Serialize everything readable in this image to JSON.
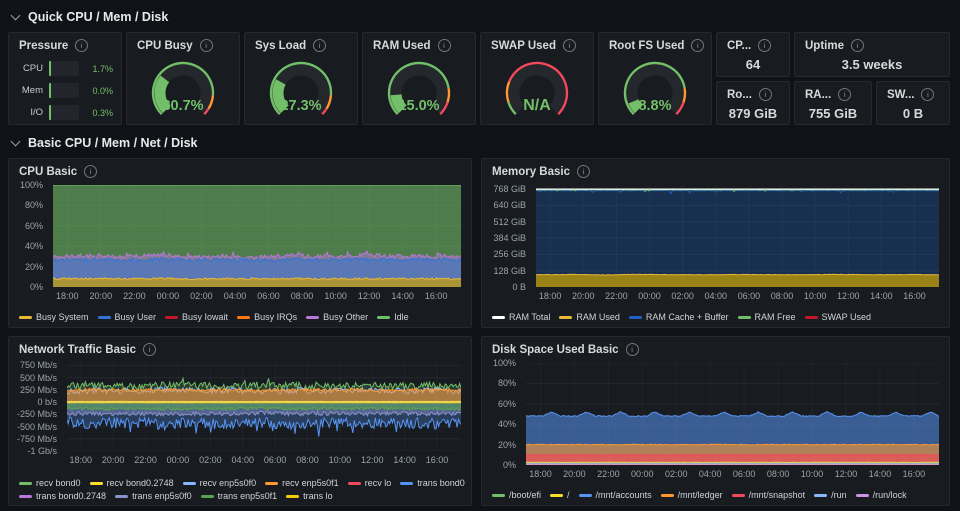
{
  "sections": [
    {
      "title": "Quick CPU / Mem / Disk"
    },
    {
      "title": "Basic CPU / Mem / Net / Disk"
    }
  ],
  "pressure": {
    "title": "Pressure",
    "rows": [
      {
        "label": "CPU",
        "value": "1.7%"
      },
      {
        "label": "Mem",
        "value": "0.0%"
      },
      {
        "label": "I/O",
        "value": "0.3%"
      }
    ],
    "bar_color": "#73bf69"
  },
  "gauges": [
    {
      "title": "CPU Busy",
      "display": "30.7%",
      "percent": 30.7,
      "value_color": "#73bf69",
      "thresholds": [
        {
          "to": 85,
          "color": "#73bf69"
        },
        {
          "to": 95,
          "color": "#ff9830"
        },
        {
          "to": 100,
          "color": "#f2495c"
        }
      ]
    },
    {
      "title": "Sys Load",
      "display": "27.3%",
      "percent": 27.3,
      "value_color": "#73bf69",
      "thresholds": [
        {
          "to": 85,
          "color": "#73bf69"
        },
        {
          "to": 95,
          "color": "#ff9830"
        },
        {
          "to": 100,
          "color": "#f2495c"
        }
      ]
    },
    {
      "title": "RAM Used",
      "display": "15.0%",
      "percent": 15.0,
      "value_color": "#73bf69",
      "thresholds": [
        {
          "to": 80,
          "color": "#73bf69"
        },
        {
          "to": 90,
          "color": "#ff9830"
        },
        {
          "to": 100,
          "color": "#f2495c"
        }
      ]
    },
    {
      "title": "SWAP Used",
      "display": "N/A",
      "percent": null,
      "value_color": "#73bf69",
      "thresholds": [
        {
          "to": 10,
          "color": "#73bf69"
        },
        {
          "to": 25,
          "color": "#ff9830"
        },
        {
          "to": 100,
          "color": "#f2495c"
        }
      ]
    },
    {
      "title": "Root FS Used",
      "display": "8.8%",
      "percent": 8.8,
      "value_color": "#73bf69",
      "thresholds": [
        {
          "to": 80,
          "color": "#73bf69"
        },
        {
          "to": 90,
          "color": "#ff9830"
        },
        {
          "to": 100,
          "color": "#f2495c"
        }
      ]
    }
  ],
  "stats": [
    {
      "title": "CP...",
      "value": "64"
    },
    {
      "title": "Uptime",
      "value": "3.5 weeks"
    },
    {
      "title": "Ro...",
      "value": "879 GiB"
    },
    {
      "title": "RA...",
      "value": "755 GiB"
    },
    {
      "title": "SW...",
      "value": "0 B"
    }
  ],
  "chart_data": [
    {
      "id": "cpu-basic",
      "title": "CPU Basic",
      "type": "area",
      "stacked": true,
      "ylim": [
        0,
        100
      ],
      "yticks": [
        {
          "v": 0,
          "label": "0%"
        },
        {
          "v": 20,
          "label": "20%"
        },
        {
          "v": 40,
          "label": "40%"
        },
        {
          "v": 60,
          "label": "60%"
        },
        {
          "v": 80,
          "label": "80%"
        },
        {
          "v": 100,
          "label": "100%"
        }
      ],
      "xticks": [
        "18:00",
        "20:00",
        "22:00",
        "00:00",
        "02:00",
        "04:00",
        "06:00",
        "08:00",
        "10:00",
        "12:00",
        "14:00",
        "16:00"
      ],
      "legend": [
        {
          "label": "Busy System",
          "color": "#eab839"
        },
        {
          "label": "Busy User",
          "color": "#3274d9"
        },
        {
          "label": "Busy Iowait",
          "color": "#c4162a"
        },
        {
          "label": "Busy IRQs",
          "color": "#ff780a"
        },
        {
          "label": "Busy Other",
          "color": "#b877d9"
        },
        {
          "label": "Idle",
          "color": "#73bf69"
        }
      ],
      "series": [
        {
          "name": "Idle",
          "color": "#73bf69",
          "points": [
            100
          ],
          "noise": 0,
          "fill": 0.6,
          "lw": 1
        },
        {
          "name": "Busy Other",
          "color": "#b877d9",
          "points": [
            30,
            31,
            29.5,
            31.5,
            30,
            30.5,
            29.5,
            31,
            30,
            31.5,
            30,
            30.5,
            30
          ],
          "noise": 2.0,
          "fill": 0.5,
          "lw": 1,
          "spikeP": 0.05,
          "spikeAmp": 3
        },
        {
          "name": "Busy User",
          "color": "#3274d9",
          "points": [
            26,
            27,
            26,
            27.5,
            26.5,
            27,
            26,
            27,
            26.5,
            27.2,
            26.3,
            27,
            26.5
          ],
          "noise": 1.8,
          "fill": 0.5,
          "lw": 1
        },
        {
          "name": "Busy System",
          "color": "#eab839",
          "fillColor": "#cca300",
          "points": [
            8,
            8.3,
            7.8,
            8.4,
            8,
            8.2,
            7.9,
            8.3,
            8,
            8.2,
            7.9,
            8.2,
            8
          ],
          "noise": 0.9,
          "fill": 0.7,
          "lw": 1
        },
        {
          "name": "Busy Iowait",
          "color": "#c4162a",
          "points": [
            0
          ],
          "noise": 0,
          "fill": 0,
          "lw": 0
        },
        {
          "name": "Busy IRQs",
          "color": "#ff780a",
          "points": [
            0
          ],
          "noise": 0,
          "fill": 0,
          "lw": 0
        }
      ]
    },
    {
      "id": "memory-basic",
      "title": "Memory Basic",
      "type": "area",
      "unit": "GiB",
      "ylim": [
        0,
        800
      ],
      "yticks": [
        {
          "v": 0,
          "label": "0 B"
        },
        {
          "v": 128,
          "label": "128 GiB"
        },
        {
          "v": 256,
          "label": "256 GiB"
        },
        {
          "v": 384,
          "label": "384 GiB"
        },
        {
          "v": 512,
          "label": "512 GiB"
        },
        {
          "v": 640,
          "label": "640 GiB"
        },
        {
          "v": 768,
          "label": "768 GiB"
        }
      ],
      "xticks": [
        "18:00",
        "20:00",
        "22:00",
        "00:00",
        "02:00",
        "04:00",
        "06:00",
        "08:00",
        "10:00",
        "12:00",
        "14:00",
        "16:00"
      ],
      "legend": [
        {
          "label": "RAM Total",
          "color": "#ffffff"
        },
        {
          "label": "RAM Used",
          "color": "#eab839"
        },
        {
          "label": "RAM Cache + Buffer",
          "color": "#1f60c4"
        },
        {
          "label": "RAM Free",
          "color": "#73bf69"
        },
        {
          "label": "SWAP Used",
          "color": "#c4162a"
        }
      ],
      "series": [
        {
          "name": "RAM Cache + Buffer",
          "color": "#1f60c4",
          "points": [
            756
          ],
          "noise": 2.2,
          "fill": 0.3,
          "lw": 1,
          "spikeP": 0.03,
          "spikeAmp": -22
        },
        {
          "name": "RAM Used",
          "color": "#eab839",
          "fillColor": "#cca300",
          "points": [
            96,
            98,
            95,
            99,
            97,
            96,
            98,
            96,
            97,
            98,
            96,
            97,
            96
          ],
          "noise": 2,
          "fill": 0.72,
          "lw": 1
        },
        {
          "name": "RAM Free",
          "color": "#73bf69",
          "points": [
            762
          ],
          "noise": 1.5,
          "fill": 0,
          "lw": 1,
          "spikeP": 0.03,
          "spikeAmp": -14
        },
        {
          "name": "RAM Total",
          "color": "#ffffff",
          "points": [
            768
          ],
          "noise": 0,
          "fill": 0,
          "lw": 1.2
        },
        {
          "name": "SWAP Used",
          "color": "#c4162a",
          "points": [
            0
          ],
          "noise": 0,
          "fill": 0,
          "lw": 0
        }
      ]
    },
    {
      "id": "network-traffic-basic",
      "title": "Network Traffic Basic",
      "type": "line",
      "zeroLine": true,
      "ylim": [
        -1000,
        800
      ],
      "yticks": [
        {
          "v": 750,
          "label": "750 Mb/s"
        },
        {
          "v": 500,
          "label": "500 Mb/s"
        },
        {
          "v": 250,
          "label": "250 Mb/s"
        },
        {
          "v": 0,
          "label": "0 b/s"
        },
        {
          "v": -250,
          "label": "-250 Mb/s"
        },
        {
          "v": -500,
          "label": "-500 Mb/s"
        },
        {
          "v": -750,
          "label": "-750 Mb/s"
        },
        {
          "v": -1000,
          "label": "-1 Gb/s"
        }
      ],
      "xticks": [
        "18:00",
        "20:00",
        "22:00",
        "00:00",
        "02:00",
        "04:00",
        "06:00",
        "08:00",
        "10:00",
        "12:00",
        "14:00",
        "16:00"
      ],
      "legend": [
        {
          "label": "recv bond0",
          "color": "#73bf69"
        },
        {
          "label": "recv bond0.2748",
          "color": "#fade2a"
        },
        {
          "label": "recv enp5s0f0",
          "color": "#8ab8ff"
        },
        {
          "label": "recv enp5s0f1",
          "color": "#ff9830"
        },
        {
          "label": "recv lo",
          "color": "#f2495c"
        },
        {
          "label": "trans bond0",
          "color": "#5794f2"
        },
        {
          "label": "trans bond0.2748",
          "color": "#b877d9"
        },
        {
          "label": "trans enp5s0f0",
          "color": "#8a93c9"
        },
        {
          "label": "trans enp5s0f1",
          "color": "#56a64b"
        },
        {
          "label": "trans lo",
          "color": "#f2cc0c"
        }
      ],
      "series": [
        {
          "name": "recv bond0",
          "color": "#73bf69",
          "points": [
            320,
            340,
            310,
            350,
            330,
            320,
            345,
            330,
            315,
            340,
            325,
            335,
            330
          ],
          "noise": 75,
          "fill": 0.22,
          "lw": 1,
          "spikeP": 0.05,
          "spikeAmp": 110
        },
        {
          "name": "recv enp5s0f0",
          "color": "#8ab8ff",
          "points": [
            215,
            240,
            220,
            250,
            230,
            240,
            218,
            235,
            225,
            245,
            222,
            240,
            230
          ],
          "noise": 60,
          "fill": 0.2,
          "lw": 1
        },
        {
          "name": "recv enp5s0f1",
          "color": "#ff9830",
          "points": [
            245,
            258,
            240,
            260,
            248,
            252,
            242,
            256,
            246,
            252,
            240,
            254,
            246
          ],
          "noise": 30,
          "fill": 0.55,
          "lw": 1
        },
        {
          "name": "trans bond0",
          "color": "#5794f2",
          "points": [
            -410,
            -440,
            -415,
            -455,
            -425,
            -445,
            -418,
            -450,
            -428,
            -440,
            -420,
            -445,
            -430
          ],
          "noise": 115,
          "fill": 0.3,
          "lw": 1,
          "spikeP": 0.06,
          "spikeAmp": -170
        },
        {
          "name": "trans enp5s0f0",
          "color": "#8a93c9",
          "points": [
            -225,
            -245,
            -228,
            -248,
            -232,
            -242,
            -226,
            -244,
            -230,
            -240,
            -228,
            -242,
            -233
          ],
          "noise": 40,
          "fill": 0.45,
          "lw": 1
        },
        {
          "name": "trans enp5s0f1",
          "color": "#56a64b",
          "points": [
            -122,
            -138,
            -126,
            -142,
            -130,
            -140,
            -124,
            -138,
            -128,
            -136,
            -124,
            -140,
            -132
          ],
          "noise": 32,
          "fill": 0.5,
          "lw": 1
        },
        {
          "name": "recv lo",
          "color": "#f2495c",
          "points": [
            3
          ],
          "noise": 1,
          "fill": 0,
          "lw": 1
        },
        {
          "name": "trans bond0.2748",
          "color": "#b877d9",
          "points": [
            -4
          ],
          "noise": 1.5,
          "fill": 0,
          "lw": 1
        },
        {
          "name": "recv bond0.2748",
          "color": "#fade2a",
          "points": [
            9
          ],
          "noise": 2,
          "fill": 0,
          "lw": 1.4
        },
        {
          "name": "trans lo",
          "color": "#f2cc0c",
          "points": [
            -10
          ],
          "noise": 2,
          "fill": 0,
          "lw": 1.4
        }
      ]
    },
    {
      "id": "disk-space-used-basic",
      "title": "Disk Space Used Basic",
      "type": "area",
      "ylim": [
        0,
        100
      ],
      "yticks": [
        {
          "v": 0,
          "label": "0%"
        },
        {
          "v": 20,
          "label": "20%"
        },
        {
          "v": 40,
          "label": "40%"
        },
        {
          "v": 60,
          "label": "60%"
        },
        {
          "v": 80,
          "label": "80%"
        },
        {
          "v": 100,
          "label": "100%"
        }
      ],
      "xticks": [
        "18:00",
        "20:00",
        "22:00",
        "00:00",
        "02:00",
        "04:00",
        "06:00",
        "08:00",
        "10:00",
        "12:00",
        "14:00",
        "16:00"
      ],
      "legend": [
        {
          "label": "/boot/efi",
          "color": "#73bf69"
        },
        {
          "label": "/",
          "color": "#fade2a"
        },
        {
          "label": "/mnt/accounts",
          "color": "#5794f2"
        },
        {
          "label": "/mnt/ledger",
          "color": "#ff9830"
        },
        {
          "label": "/mnt/snapshot",
          "color": "#f2495c"
        },
        {
          "label": "/run",
          "color": "#8ab8ff"
        },
        {
          "label": "/run/lock",
          "color": "#ca95e5"
        }
      ],
      "series": [
        {
          "name": "/mnt/accounts",
          "color": "#5794f2",
          "points": [
            48,
            48,
            48,
            52,
            48,
            48,
            48,
            52,
            48,
            48,
            48,
            52,
            48,
            48,
            48,
            52,
            48,
            48,
            48,
            52,
            48,
            48,
            48,
            52,
            48,
            48,
            48,
            52,
            48,
            48,
            48,
            52,
            48,
            48,
            48,
            52,
            48,
            48,
            48,
            52,
            48,
            48,
            48,
            52,
            48,
            48,
            48,
            52,
            48
          ],
          "noise": 0.5,
          "fill": 0.55,
          "lw": 1
        },
        {
          "name": "/mnt/ledger",
          "color": "#ff9830",
          "points": [
            20
          ],
          "noise": 0.4,
          "fill": 0.6,
          "lw": 1
        },
        {
          "name": "/mnt/snapshot",
          "color": "#f2495c",
          "points": [
            10
          ],
          "noise": 0.3,
          "fill": 0.65,
          "lw": 1
        },
        {
          "name": "/",
          "color": "#fade2a",
          "points": [
            2.6
          ],
          "noise": 0.15,
          "fill": 0.5,
          "lw": 1
        },
        {
          "name": "/run",
          "color": "#8ab8ff",
          "points": [
            1.8
          ],
          "noise": 0.1,
          "fill": 0,
          "lw": 1
        },
        {
          "name": "/boot/efi",
          "color": "#73bf69",
          "points": [
            1.2
          ],
          "noise": 0.1,
          "fill": 0,
          "lw": 1
        },
        {
          "name": "/run/lock",
          "color": "#ca95e5",
          "points": [
            0.9
          ],
          "noise": 0.1,
          "fill": 0.4,
          "lw": 1
        }
      ]
    }
  ]
}
